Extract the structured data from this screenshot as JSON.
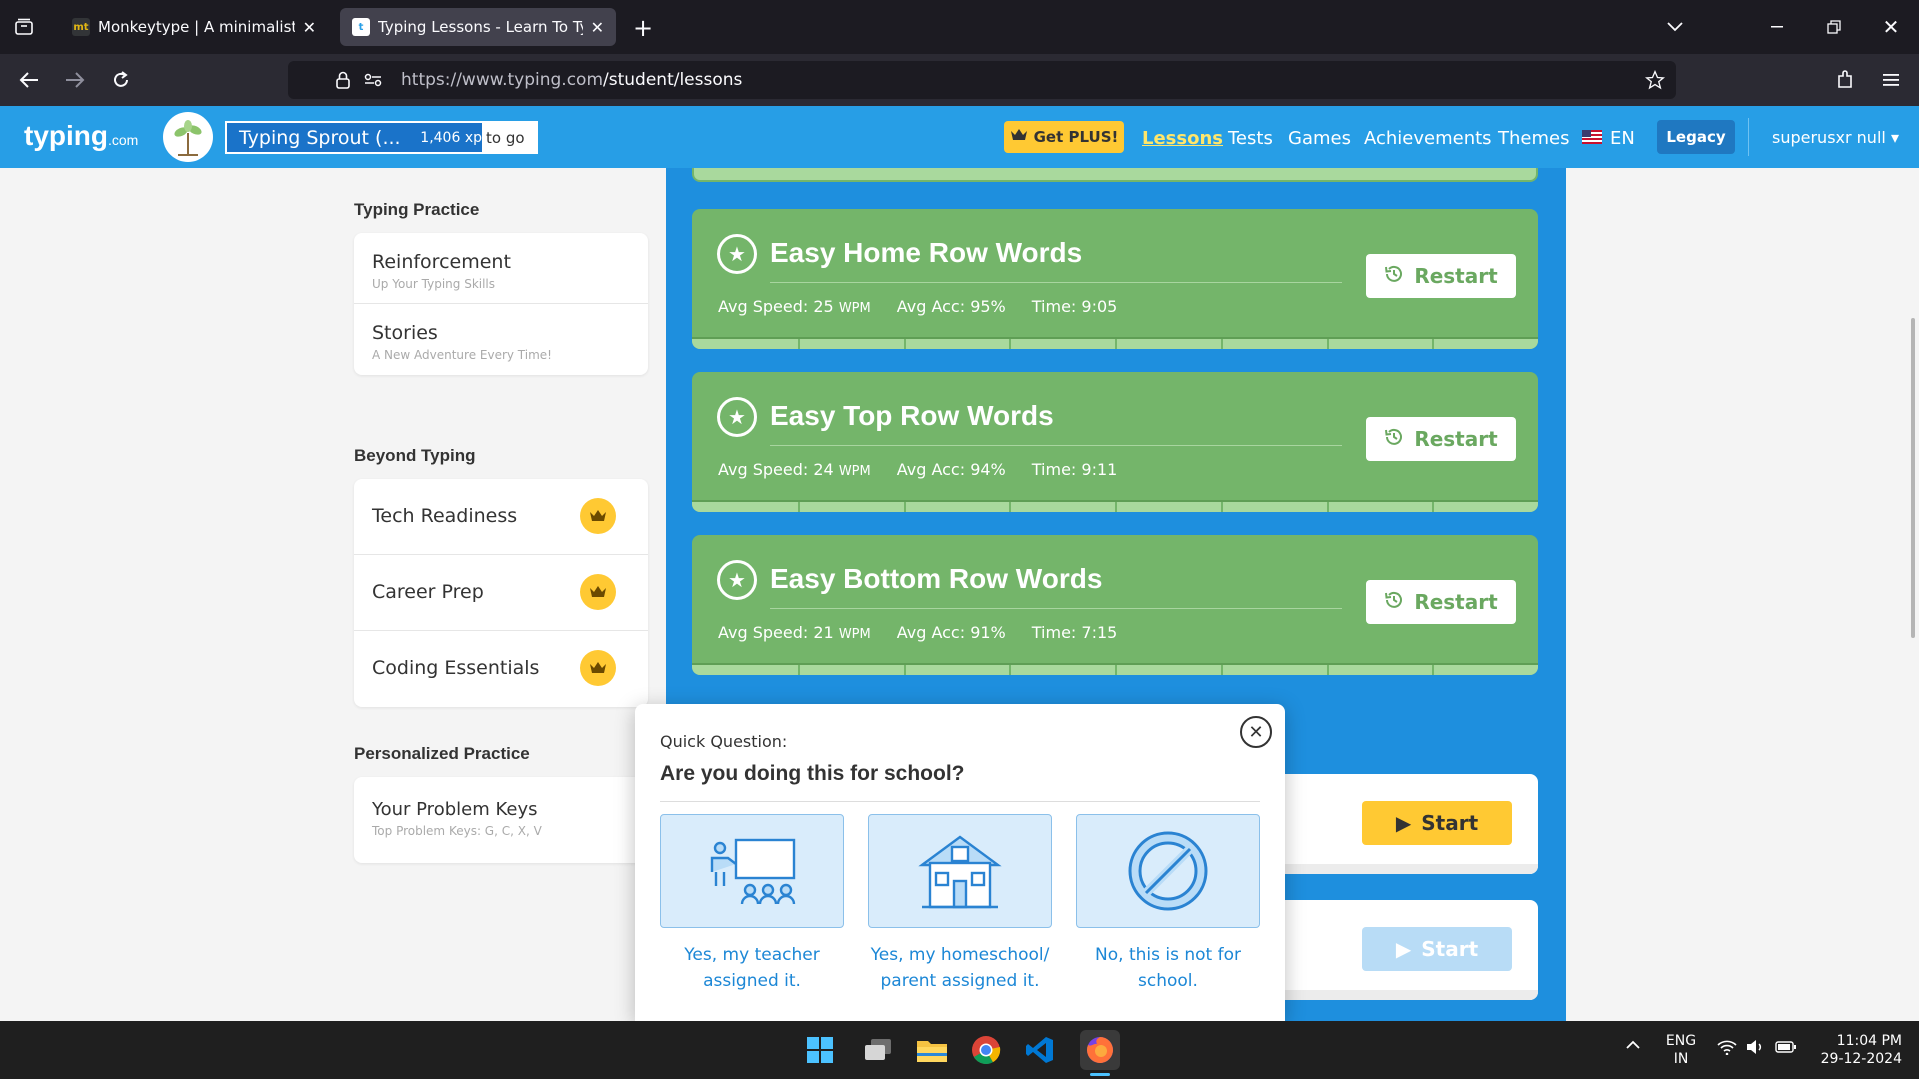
{
  "browser": {
    "tabs": [
      {
        "favicon": "mt",
        "title": "Monkeytype | A minimalistic, c"
      },
      {
        "favicon": "t",
        "title": "Typing Lessons - Learn To Type"
      }
    ],
    "url_host": "https://www.typing.com",
    "url_path": "/student/lessons"
  },
  "header": {
    "logo": "typing",
    "logo_suffix": ".com",
    "level_name": "Typing Sprout (...",
    "xp": "1,406 xp",
    "xp_suffix": "to go",
    "plus_label": "Get PLUS!",
    "nav": [
      "Lessons",
      "Tests",
      "Games",
      "Achievements",
      "Themes"
    ],
    "language": "EN",
    "legacy_label": "Legacy",
    "user": "superusxr null"
  },
  "sidebar": {
    "typing_practice_title": "Typing Practice",
    "typing_practice": [
      {
        "title": "Reinforcement",
        "sub": "Up Your Typing Skills"
      },
      {
        "title": "Stories",
        "sub": "A New Adventure Every Time!"
      }
    ],
    "beyond_title": "Beyond Typing",
    "beyond": [
      "Tech Readiness",
      "Career Prep",
      "Coding Essentials"
    ],
    "personalized_title": "Personalized Practice",
    "personalized": {
      "title": "Your Problem Keys",
      "sub": "Top Problem Keys: G, C, X, V"
    }
  },
  "lessons": [
    {
      "title": "Easy Home Row Words",
      "speed": "Avg Speed: 25",
      "acc": "Avg Acc: 95%",
      "time": "Time: 9:05",
      "action": "Restart"
    },
    {
      "title": "Easy Top Row Words",
      "speed": "Avg Speed: 24",
      "acc": "Avg Acc: 94%",
      "time": "Time: 9:11",
      "action": "Restart"
    },
    {
      "title": "Easy Bottom Row Words",
      "speed": "Avg Speed: 21",
      "acc": "Avg Acc: 91%",
      "time": "Time: 7:15",
      "action": "Restart"
    }
  ],
  "wpm_unit": "WPM",
  "start_label": "Start",
  "modal": {
    "quick": "Quick Question:",
    "heading": "Are you doing this for school?",
    "options": [
      {
        "line1": "Yes, my teacher",
        "line2": "assigned it."
      },
      {
        "line1": "Yes, my homeschool/",
        "line2": "parent assigned it."
      },
      {
        "line1": "No, this is not for",
        "line2": "school."
      }
    ]
  },
  "taskbar": {
    "lang1": "ENG",
    "lang2": "IN",
    "time": "11:04 PM",
    "date": "29-12-2024"
  }
}
